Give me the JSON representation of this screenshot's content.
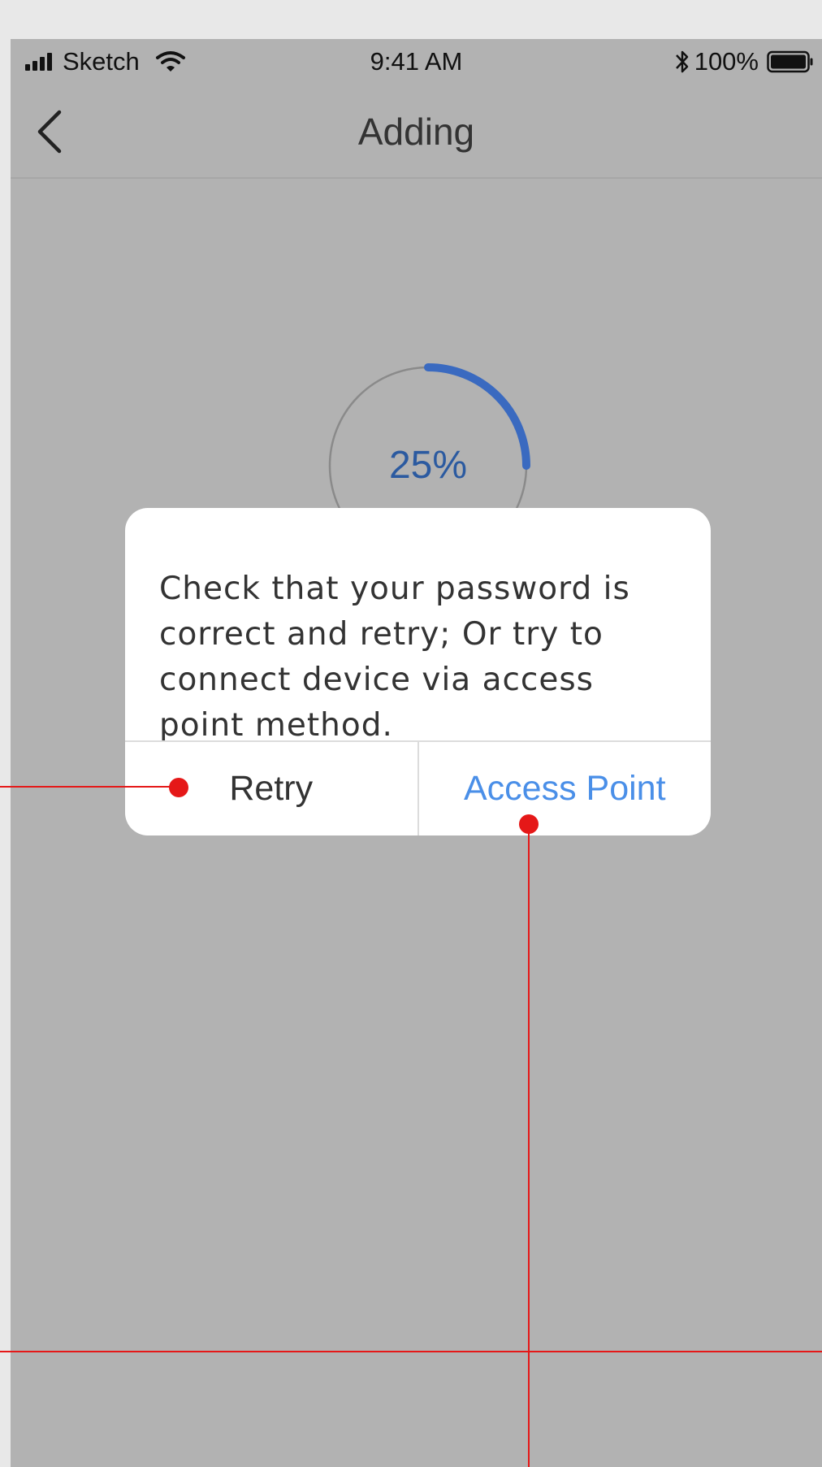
{
  "status_bar": {
    "carrier": "Sketch",
    "time": "9:41 AM",
    "battery": "100%",
    "icons": [
      "signal-icon",
      "wifi-icon",
      "bluetooth-icon",
      "battery-icon"
    ]
  },
  "nav": {
    "title": "Adding",
    "back_icon": "chevron-left-icon"
  },
  "progress": {
    "value": 0.25,
    "label": "25%",
    "track_color": "#8a8a8a",
    "fill_color": "#3a6ac0"
  },
  "dialog": {
    "message": "Check that your password is correct and retry; Or try to connect device via access point method.",
    "retry_label": "Retry",
    "access_point_label": "Access Point"
  },
  "colors": {
    "overlay": "#b2b2b2",
    "accent": "#4a8fe8",
    "annotation": "#e51818"
  }
}
